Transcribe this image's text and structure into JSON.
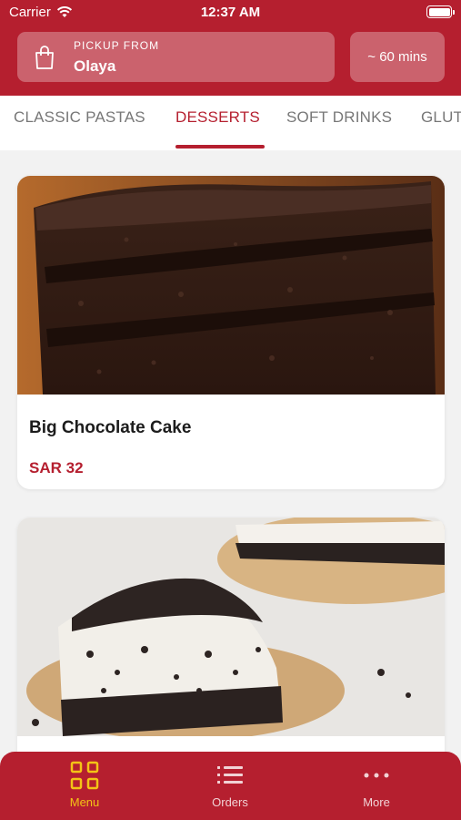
{
  "status_bar": {
    "carrier": "Carrier",
    "time": "12:37 AM"
  },
  "header": {
    "pickup_label": "PICKUP FROM",
    "pickup_location": "Olaya",
    "eta": "~ 60 mins"
  },
  "tabs": [
    "CLASSIC PASTAS",
    "DESSERTS",
    "SOFT DRINKS",
    "GLUT"
  ],
  "active_tab": "DESSERTS",
  "products": [
    {
      "name": "Big Chocolate Cake",
      "price": "SAR 32",
      "image_icon": "chocolate-cake-photo"
    },
    {
      "name": "",
      "price": "",
      "image_icon": "oreo-cheesecake-photo"
    }
  ],
  "bottom_nav": [
    {
      "label": "Menu",
      "icon": "grid-icon",
      "active": true
    },
    {
      "label": "Orders",
      "icon": "list-icon",
      "active": false
    },
    {
      "label": "More",
      "icon": "more-dots-icon",
      "active": false
    }
  ],
  "colors": {
    "brand": "#b51f2f",
    "active_nav": "#f3c316",
    "background": "#f2f2f2"
  }
}
